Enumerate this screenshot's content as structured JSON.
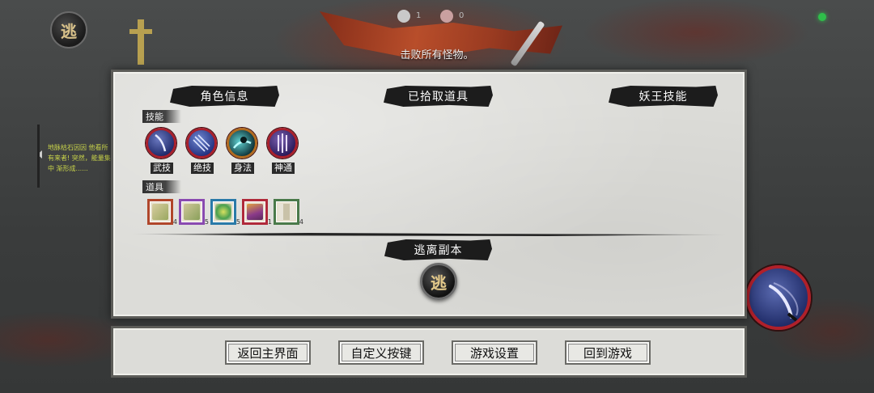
{
  "hud": {
    "objective": "击败所有怪物。",
    "escape_glyph": "逃",
    "counters": [
      {
        "icon": "skull-icon",
        "value": "1"
      },
      {
        "icon": "demon-head-icon",
        "value": "0"
      }
    ],
    "side_tip": "地脉枯石因因 他看所有来者! 突然，能量集中 渐形成......"
  },
  "panel": {
    "tabs": {
      "character": "角色信息",
      "picked_items": "已拾取道具",
      "yao_king_skills": "妖王技能"
    },
    "skills_label": "技能",
    "skills": [
      {
        "name": "武技",
        "icon": "sword-slash-icon"
      },
      {
        "name": "绝技",
        "icon": "blade-storm-icon"
      },
      {
        "name": "身法",
        "icon": "dash-icon"
      },
      {
        "name": "神通",
        "icon": "divine-blades-icon"
      }
    ],
    "items_label": "道具",
    "items": [
      {
        "icon": "jade-pendant-icon",
        "count": "4",
        "rarity_color": "#b0462a"
      },
      {
        "icon": "jade-pendant-icon",
        "count": "5",
        "rarity_color": "#8a4ab0"
      },
      {
        "icon": "green-gem-icon",
        "count": "5",
        "rarity_color": "#2a7aa8"
      },
      {
        "icon": "treasure-box-icon",
        "count": "1",
        "rarity_color": "#b02a3a"
      },
      {
        "icon": "scroll-icon",
        "count": "4",
        "rarity_color": "#4a7a4a"
      }
    ],
    "escape_section": "逃离副本",
    "escape_glyph": "逃"
  },
  "menu": {
    "return_main": "返回主界面",
    "custom_keys": "自定义按键",
    "game_settings": "游戏设置",
    "back_to_game": "回到游戏"
  },
  "colors": {
    "panel_bg": "#dcdcd8",
    "ink": "#1c1c1c",
    "skill_border": "#a8202c",
    "objective_text": "#f2f2f2",
    "tip_text": "#c8d34a"
  }
}
